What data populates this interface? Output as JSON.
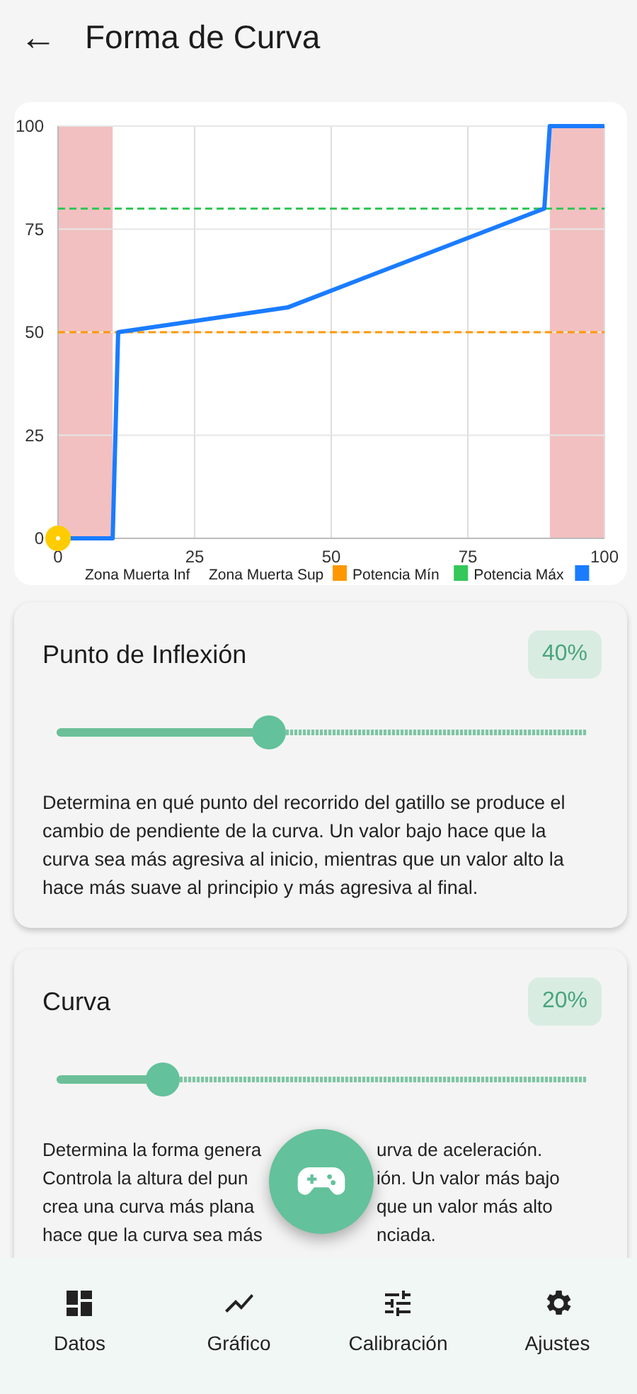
{
  "app_bar": {
    "back": "←",
    "title": "Forma de Curva"
  },
  "chart": {
    "chart_data": {
      "type": "line",
      "x": [
        0,
        10,
        11,
        42,
        89,
        90,
        100
      ],
      "xlim": [
        0,
        100
      ],
      "ylim": [
        0,
        100
      ],
      "xticks": [
        0,
        25,
        50,
        75,
        100
      ],
      "yticks": [
        0,
        25,
        50,
        75,
        100
      ],
      "grid": true,
      "series": [
        {
          "color": "#1a7cff",
          "values": [
            0,
            0,
            50,
            56,
            80,
            100,
            100
          ]
        }
      ],
      "ref_lines": [
        {
          "axis": "y",
          "value": 50,
          "color": "#ff9800",
          "line_style": "dashed"
        },
        {
          "axis": "y",
          "value": 80,
          "color": "#34c759",
          "line_style": "dashed"
        }
      ],
      "bands": [
        {
          "axis": "x",
          "from": 0,
          "to": 10,
          "color": "#f2c0c0"
        },
        {
          "axis": "x",
          "from": 90,
          "to": 100,
          "color": "#f2c0c0"
        }
      ]
    },
    "legend": [
      {
        "label": "Zona Muerta Inf"
      },
      {
        "label": "Zona Muerta Sup"
      },
      {
        "color": "#ff9800"
      },
      {
        "label": "Potencia Mín"
      },
      {
        "color": "#34c759"
      },
      {
        "label": "Potencia Máx"
      },
      {
        "color": "#1a7cff"
      }
    ]
  },
  "settings": [
    {
      "title": "Punto de Inflexión",
      "value": "40%",
      "level": 0.4,
      "description": "Determina en qué punto del recorrido del gatillo se produce el cambio de pendiente de la curva. Un valor bajo hace que la curva sea más agresiva al inicio, mientras que un valor alto la hace más suave al principio y más agresiva al final."
    },
    {
      "title": "Curva",
      "value": "20%",
      "level": 0.2,
      "description_lines": [
        {
          "left": "Determina la forma genera",
          "right": "urva de aceleración."
        },
        {
          "left": "Controla la altura del pun",
          "right": "ión. Un valor más bajo"
        },
        {
          "left": "crea una curva más plana",
          "right": "que un valor más alto"
        },
        {
          "left": "hace que la curva sea más",
          "right": "nciada."
        }
      ]
    }
  ],
  "nav": [
    {
      "kind": "dashboard",
      "label": "Datos",
      "selected": false
    },
    {
      "kind": "chart",
      "label": "Gráfico",
      "selected": false
    },
    {
      "kind": "tune",
      "label": "Calibración",
      "selected": false
    },
    {
      "kind": "settings",
      "label": "Ajustes",
      "selected": false
    }
  ]
}
